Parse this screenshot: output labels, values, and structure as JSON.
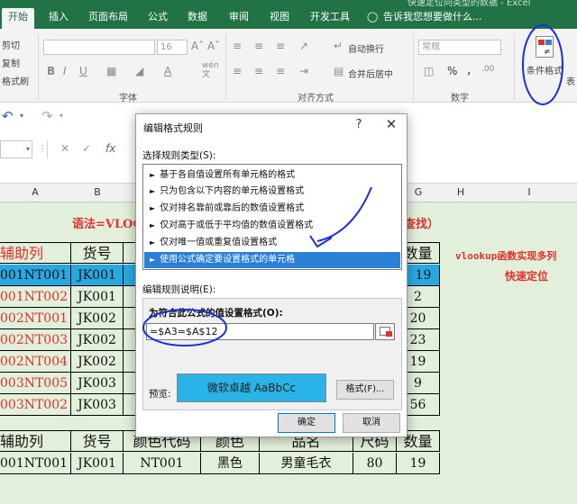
{
  "ribbon": {
    "tabs": [
      "开始",
      "插入",
      "页面布局",
      "公式",
      "数据",
      "审阅",
      "视图",
      "开发工具"
    ],
    "tell_me": "告诉我您想要做什么...",
    "title_fragment": "快速定位同类型的数据 - Excel",
    "clipboard": {
      "cut": "剪切",
      "copy": "复制",
      "painter": "格式刷"
    },
    "font": {
      "size": "16",
      "group_label": "字体",
      "wen": "wén\n文"
    },
    "alignment": {
      "wrap": "自动换行",
      "merge": "合并后居中",
      "group_label": "对齐方式"
    },
    "number": {
      "format": "常规",
      "group_label": "数字",
      "percent": "%",
      "comma": ","
    },
    "styles": {
      "conditional_format": "条件格式",
      "table_format_partial": "表"
    }
  },
  "formula_bar": {
    "name_box": "",
    "fx": "fx",
    "cancel": "✕",
    "enter": "✓"
  },
  "columns": [
    "A",
    "B",
    "G",
    "H",
    "I"
  ],
  "sheet": {
    "syntax_left": "语法=VLOOK",
    "syntax_right": "查找）",
    "note_line1": "vlookup函数实现多列",
    "note_line2": "快速定位",
    "header": {
      "a": "辅助列",
      "b": "货号",
      "g": "数量"
    },
    "rows": [
      {
        "a": "001NT001",
        "b": "JK001",
        "g": "19"
      },
      {
        "a": "001NT002",
        "b": "JK001",
        "g": "2"
      },
      {
        "a": "002NT001",
        "b": "JK002",
        "g": "20"
      },
      {
        "a": "002NT003",
        "b": "JK002",
        "g": "23"
      },
      {
        "a": "002NT004",
        "b": "JK002",
        "g": "19"
      },
      {
        "a": "003NT005",
        "b": "JK003",
        "g": "9"
      },
      {
        "a": "003NT002",
        "b": "JK003",
        "g": "56"
      }
    ],
    "lookup_header": {
      "a": "辅助列",
      "b": "货号",
      "c": "颜色代码",
      "d": "颜色",
      "e": "品名",
      "f": "尺码",
      "g": "数量"
    },
    "lookup_row": {
      "a": "001NT001",
      "b": "JK001",
      "c": "NT001",
      "d": "黑色",
      "e": "男童毛衣",
      "f": "80",
      "g": "19"
    }
  },
  "dialog": {
    "title": "编辑格式规则",
    "help": "?",
    "close": "✕",
    "rule_type_label": "选择规则类型(S):",
    "rules": [
      "基于各自值设置所有单元格的格式",
      "只为包含以下内容的单元格设置格式",
      "仅对排名靠前或靠后的数值设置格式",
      "仅对高于或低于平均值的数值设置格式",
      "仅对唯一值或重复值设置格式",
      "使用公式确定要设置格式的单元格"
    ],
    "selected_rule_index": 5,
    "description_label": "编辑规则说明(E):",
    "formula_label": "为符合此公式的值设置格式(O):",
    "formula_value": "=$A3=$A$12",
    "preview_label": "预览:",
    "preview_sample": "微软卓越  AaBbCc",
    "format_button": "格式(F)...",
    "ok_button": "确定",
    "cancel_button": "取消"
  },
  "colors": {
    "ribbon_green": "#217346",
    "sheet_fill": "#e2efda",
    "accent_red": "#e0312e",
    "preview_fill": "#29b3e6",
    "selection_blue": "#2a7fd6",
    "ink_blue": "#1a2fd6"
  }
}
